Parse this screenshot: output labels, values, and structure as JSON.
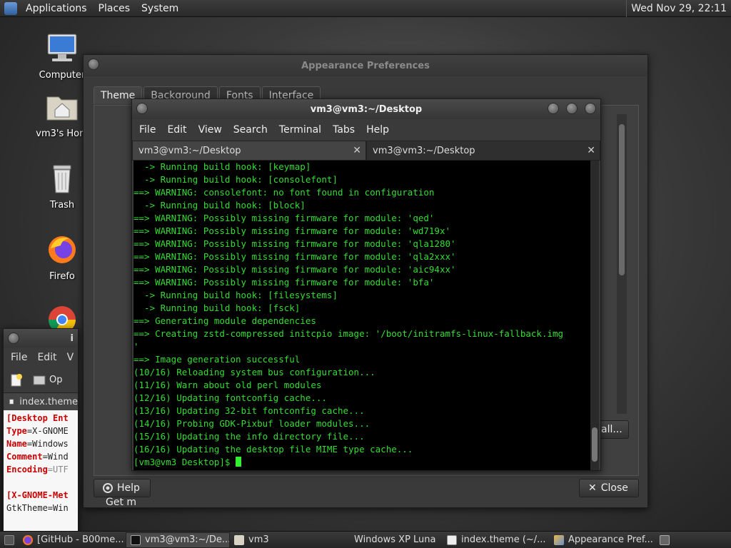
{
  "top_panel": {
    "menus": [
      "Applications",
      "Places",
      "System"
    ],
    "clock": "Wed Nov 29, 22:11"
  },
  "desktop": {
    "icons": [
      {
        "label": "Computer",
        "icon": "computer-icon"
      },
      {
        "label": "vm3's Hom",
        "icon": "home-folder-icon"
      },
      {
        "label": "Trash",
        "icon": "trash-icon"
      },
      {
        "label": "Firefo",
        "icon": "firefox-icon"
      },
      {
        "label": "",
        "icon": "chrome-icon"
      }
    ]
  },
  "appearance": {
    "title": "Appearance Preferences",
    "tabs": [
      "Theme",
      "Background",
      "Fonts",
      "Interface"
    ],
    "get_more_text": "Get m",
    "install_button": "all...",
    "help_button": "Help",
    "close_button": "Close"
  },
  "gedit": {
    "title": "i",
    "menus": [
      "File",
      "Edit",
      "V"
    ],
    "open_label": "Op",
    "doc_tab": "index.theme",
    "code_lines": [
      {
        "key": "[Desktop Ent",
        "value": ""
      },
      {
        "key": "Type",
        "value": "=X-GNOME"
      },
      {
        "key": "Name",
        "value": "=Windows"
      },
      {
        "key": "Comment",
        "value": "=Wind"
      },
      {
        "key": "Encoding",
        "value": "=UTF"
      },
      {
        "key": "",
        "value": ""
      },
      {
        "key": "[X-GNOME-Met",
        "value": ""
      },
      {
        "key": "",
        "value": "GtkTheme=Win"
      }
    ]
  },
  "terminal": {
    "title": "vm3@vm3:~/Desktop",
    "menus": [
      "File",
      "Edit",
      "View",
      "Search",
      "Terminal",
      "Tabs",
      "Help"
    ],
    "tabs": [
      "vm3@vm3:~/Desktop",
      "vm3@vm3:~/Desktop"
    ],
    "lines": [
      "  -> Running build hook: [keymap]",
      "  -> Running build hook: [consolefont]",
      "==> WARNING: consolefont: no font found in configuration",
      "  -> Running build hook: [block]",
      "==> WARNING: Possibly missing firmware for module: 'qed'",
      "==> WARNING: Possibly missing firmware for module: 'wd719x'",
      "==> WARNING: Possibly missing firmware for module: 'qla1280'",
      "==> WARNING: Possibly missing firmware for module: 'qla2xxx'",
      "==> WARNING: Possibly missing firmware for module: 'aic94xx'",
      "==> WARNING: Possibly missing firmware for module: 'bfa'",
      "  -> Running build hook: [filesystems]",
      "  -> Running build hook: [fsck]",
      "==> Generating module dependencies",
      "==> Creating zstd-compressed initcpio image: '/boot/initramfs-linux-fallback.img",
      "'",
      "==> Image generation successful",
      "(10/16) Reloading system bus configuration...",
      "(11/16) Warn about old perl modules",
      "(12/16) Updating fontconfig cache...",
      "(13/16) Updating 32-bit fontconfig cache...",
      "(14/16) Probing GDK-Pixbuf loader modules...",
      "(15/16) Updating the info directory file...",
      "(16/16) Updating the desktop file MIME type cache..."
    ],
    "prompt": "[vm3@vm3 Desktop]$ "
  },
  "taskbar": {
    "items": [
      {
        "label": "[GitHub - B00me...",
        "icon": "firefox-icon",
        "active": false
      },
      {
        "label": "vm3@vm3:~/De...",
        "icon": "terminal-icon",
        "active": true
      },
      {
        "label": "vm3",
        "icon": "folder-icon",
        "active": false
      },
      {
        "label": "Windows XP Luna",
        "icon": "",
        "active": false
      },
      {
        "label": "index.theme (~/...",
        "icon": "text-editor-icon",
        "active": false
      },
      {
        "label": "Appearance Pref...",
        "icon": "appearance-icon",
        "active": false
      }
    ]
  },
  "colors": {
    "terminal_text": "#33dd33",
    "terminal_bg": "#000000"
  }
}
